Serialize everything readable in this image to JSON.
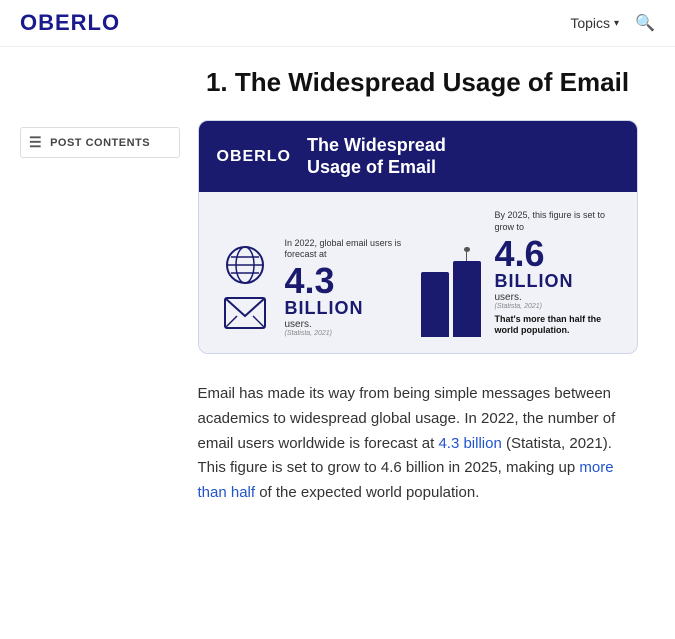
{
  "header": {
    "logo": "OBERLO",
    "nav": {
      "topics_label": "Topics",
      "search_icon": "search"
    }
  },
  "sidebar": {
    "post_contents_label": "POST CONTENTS"
  },
  "article": {
    "title": "1. The Widespread Usage of Email",
    "infographic": {
      "logo": "OBERLO",
      "header_title_line1": "The Widespread",
      "header_title_line2": "Usage of Email",
      "stat1_desc": "In 2022, global email users is forecast at",
      "stat1_number": "4.3",
      "stat1_unit": "BILLION",
      "stat1_users": "users.",
      "stat1_source": "(Statista, 2021)",
      "stat2_desc": "By 2025, this figure is set to grow to",
      "stat2_number": "4.6",
      "stat2_unit": "BILLION",
      "stat2_users": "users.",
      "stat2_source": "(Statista, 2021)",
      "stat2_half": "That's more than half the world population.",
      "bar1_height": 65,
      "bar2_height": 85
    },
    "body_text": {
      "part1": "Email has made its way from being simple messages between academics to widespread global usage. In 2022, the number of email users worldwide is forecast at ",
      "link1_text": "4.3 billion",
      "link1_href": "#",
      "part2": " (Statista, 2021). This figure is set to grow to 4.6 billion in 2025, making up ",
      "link2_text": "more than half",
      "link2_href": "#",
      "part3": " of the expected world population."
    }
  }
}
